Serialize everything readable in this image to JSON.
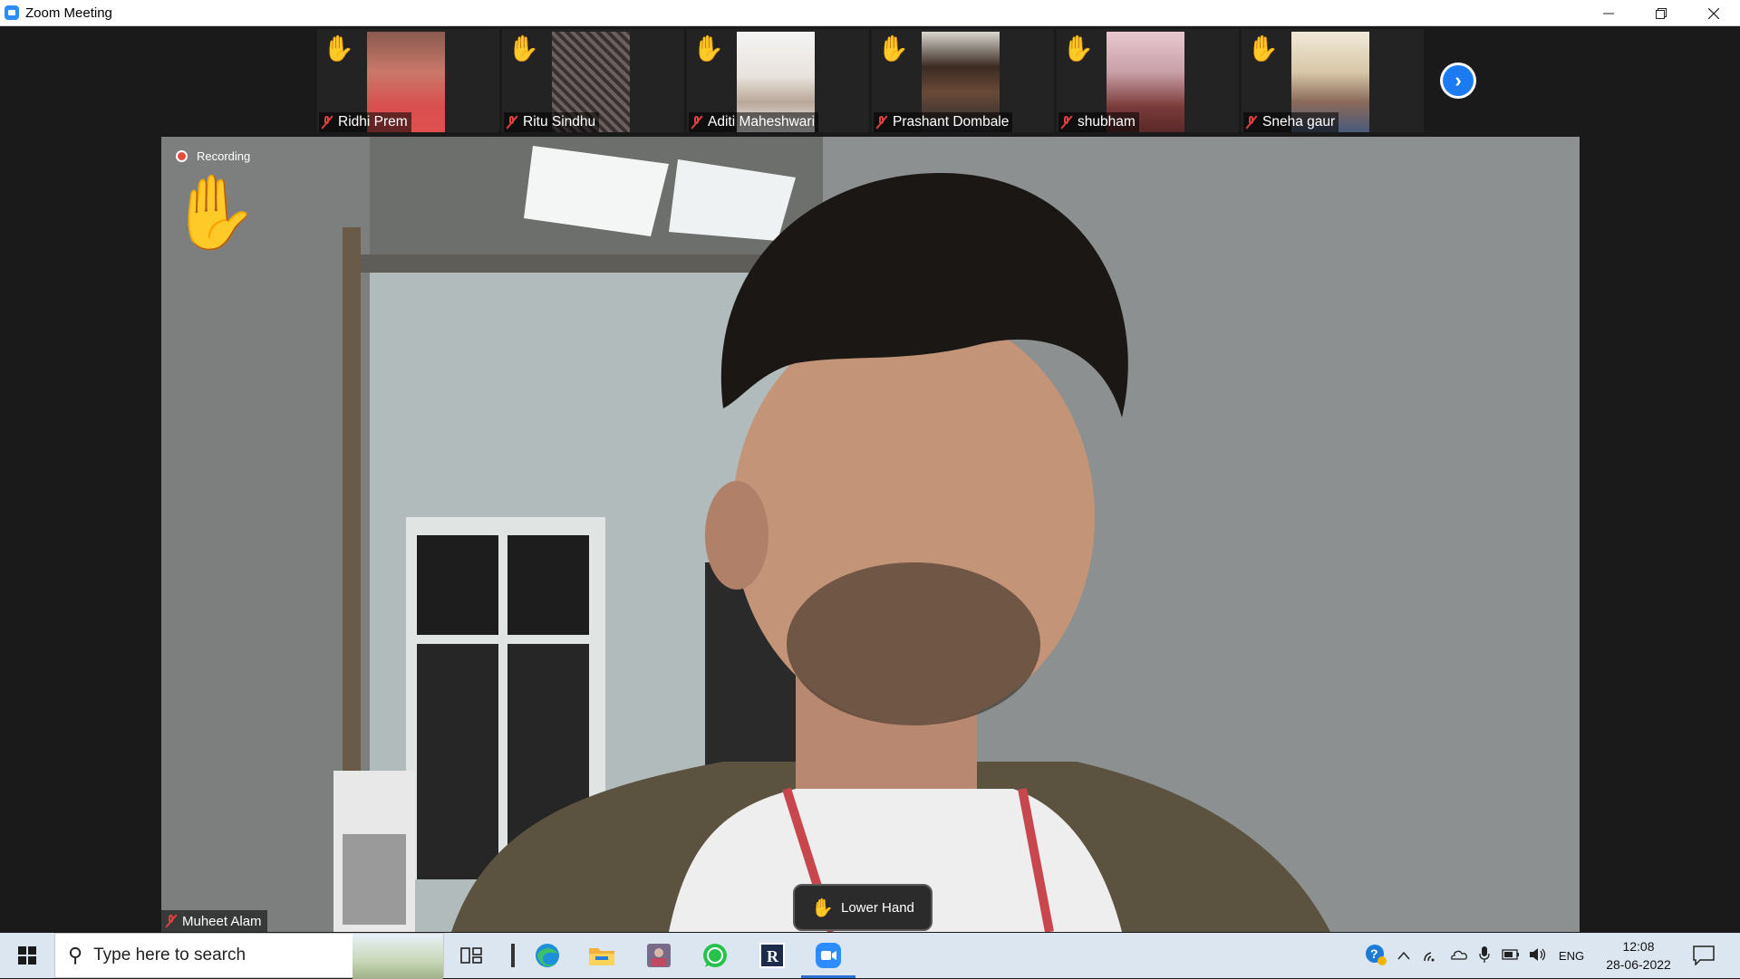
{
  "window": {
    "title": "Zoom Meeting",
    "controls": [
      "minimize-icon",
      "restore-icon",
      "close-icon"
    ]
  },
  "participants": [
    {
      "name": "Ridhi Prem",
      "hand_raised": true,
      "muted": true
    },
    {
      "name": "Ritu Sindhu",
      "hand_raised": true,
      "muted": true
    },
    {
      "name": "Aditi Maheshwari",
      "hand_raised": true,
      "muted": true
    },
    {
      "name": "Prashant Dombale",
      "hand_raised": true,
      "muted": true
    },
    {
      "name": "shubham",
      "hand_raised": true,
      "muted": true
    },
    {
      "name": "Sneha gaur",
      "hand_raised": true,
      "muted": true
    }
  ],
  "main_video": {
    "recording_label": "Recording",
    "speaker_name": "Muheet Alam",
    "hand_raised": true,
    "muted": true
  },
  "controls": {
    "lower_hand_label": "Lower Hand"
  },
  "taskbar": {
    "search_placeholder": "Type here to search",
    "apps": [
      "task-view-icon",
      "edge-icon",
      "file-explorer-icon",
      "photo-app-icon",
      "whatsapp-icon",
      "r-app-icon",
      "zoom-icon"
    ],
    "language": "ENG",
    "time": "12:08",
    "date": "28-06-2022"
  },
  "colors": {
    "accent": "#2d8cff",
    "hand": "#f5b400",
    "mic_off": "#e04040",
    "recording": "#e74c3c"
  }
}
